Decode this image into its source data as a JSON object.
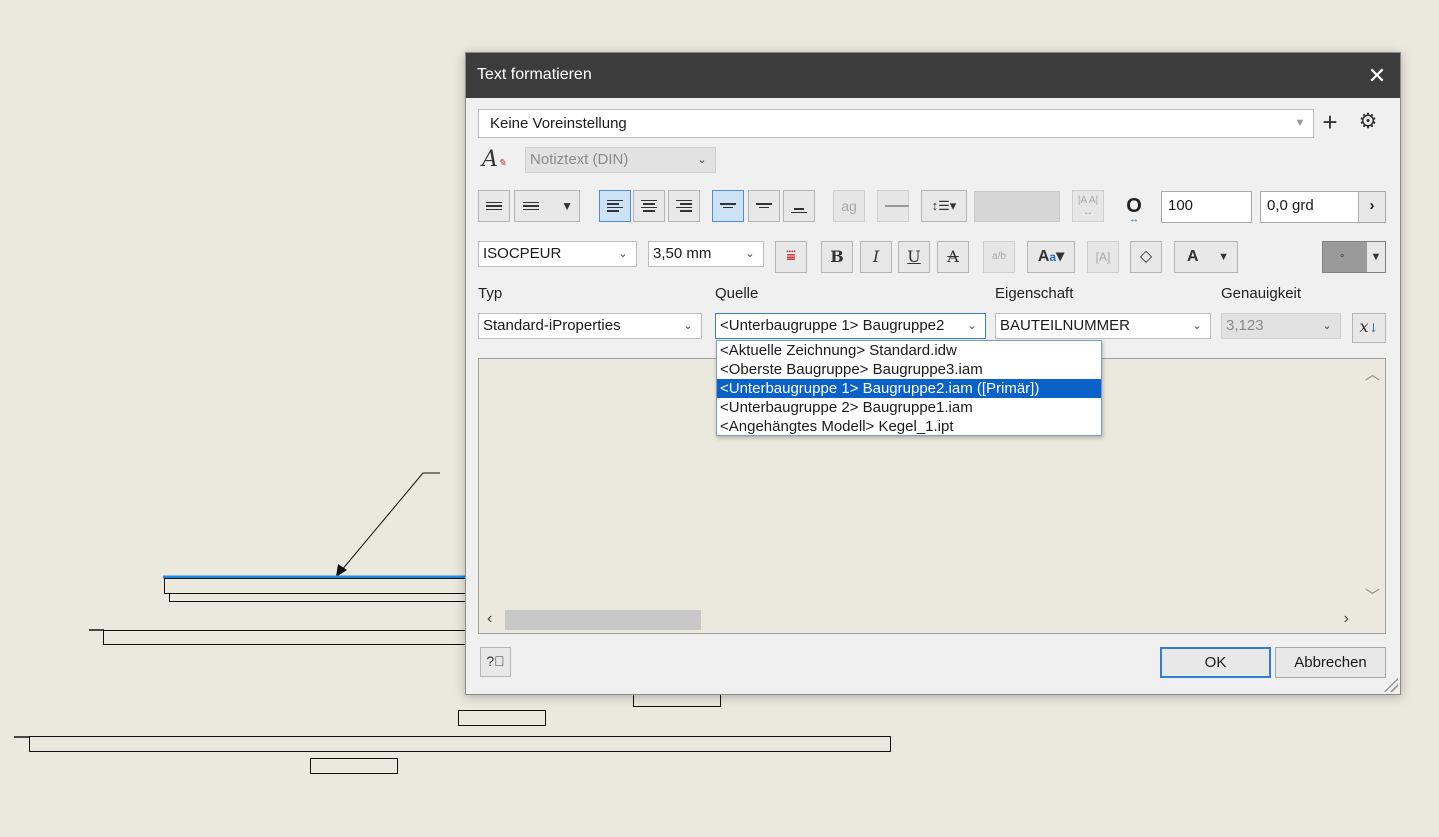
{
  "dialog": {
    "title": "Text formatieren",
    "close_icon": "close-icon",
    "preset": "Keine Voreinstellung",
    "style": "Notiztext (DIN)",
    "width_value": "100",
    "angle_value": "0,0 grd",
    "font": "ISOCPEUR",
    "size": "3,50 mm",
    "bold": "B",
    "italic": "I",
    "underline": "U",
    "strike": "A",
    "color_a": "A",
    "type_label": "Typ",
    "source_label": "Quelle",
    "property_label": "Eigenschaft",
    "precision_label": "Genauigkeit",
    "type_value": "Standard-iProperties",
    "source_value": "<Unterbaugruppe 1> Baugruppe2",
    "property_value": "BAUTEILNUMMER",
    "precision_value": "3,123",
    "source_options": [
      "<Aktuelle Zeichnung> Standard.idw",
      "<Oberste Baugruppe> Baugruppe3.iam",
      "<Unterbaugruppe 1> Baugruppe2.iam ([Primär])",
      "<Unterbaugruppe 2> Baugruppe1.iam",
      "<Angehängtes Modell> Kegel_1.ipt"
    ],
    "selected_option_index": 2,
    "ok_label": "OK",
    "cancel_label": "Abbrechen",
    "help_icon": "help-icon"
  },
  "colors": {
    "title_bar": "#3c3c3c",
    "selection": "#0a62c9",
    "drawing_background": "#ebe9dd",
    "highlight_edge": "#1f8be0"
  }
}
